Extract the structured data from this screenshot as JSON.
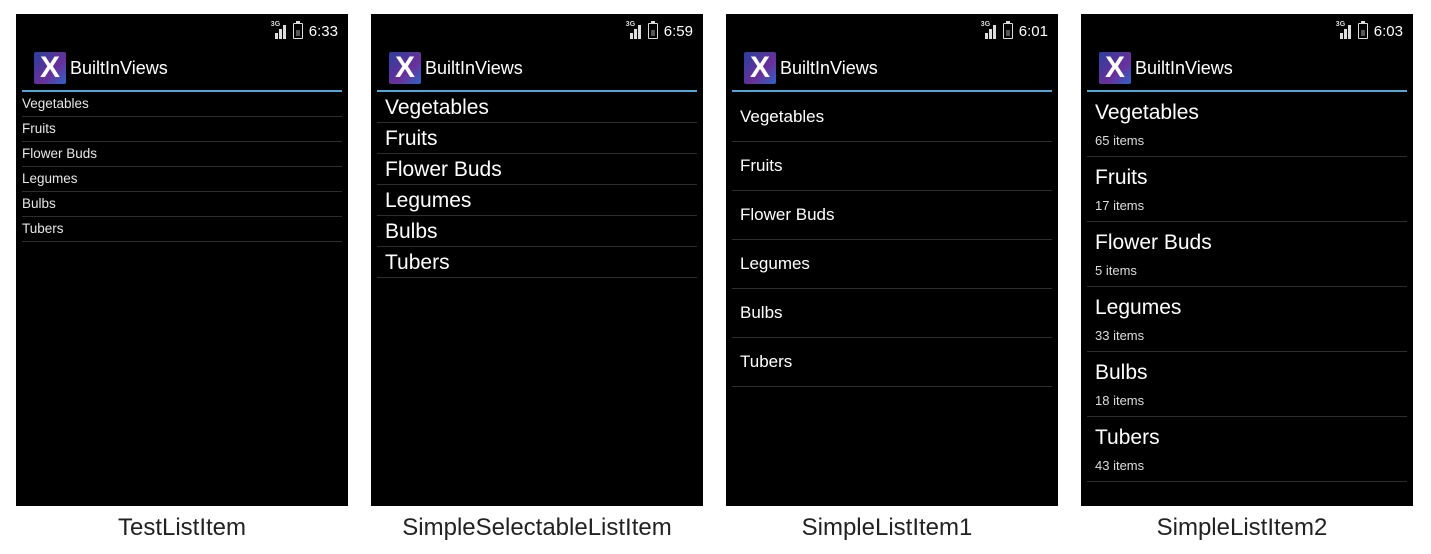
{
  "app": {
    "title": "BuiltInViews"
  },
  "panels": [
    {
      "caption": "TestListItem",
      "time": "6:33",
      "items": [
        "Vegetables",
        "Fruits",
        "Flower Buds",
        "Legumes",
        "Bulbs",
        "Tubers"
      ]
    },
    {
      "caption": "SimpleSelectableListItem",
      "time": "6:59",
      "items": [
        "Vegetables",
        "Fruits",
        "Flower Buds",
        "Legumes",
        "Bulbs",
        "Tubers"
      ]
    },
    {
      "caption": "SimpleListItem1",
      "time": "6:01",
      "items": [
        "Vegetables",
        "Fruits",
        "Flower Buds",
        "Legumes",
        "Bulbs",
        "Tubers"
      ]
    },
    {
      "caption": "SimpleListItem2",
      "time": "6:03",
      "items": [
        {
          "label": "Vegetables",
          "sub": "65 items"
        },
        {
          "label": "Fruits",
          "sub": "17 items"
        },
        {
          "label": "Flower Buds",
          "sub": "5 items"
        },
        {
          "label": "Legumes",
          "sub": "33 items"
        },
        {
          "label": "Bulbs",
          "sub": "18 items"
        },
        {
          "label": "Tubers",
          "sub": "43 items"
        }
      ]
    }
  ],
  "icons": {
    "signal": "3g-signal-icon",
    "battery": "battery-icon",
    "logo": "xamarin-logo-icon"
  },
  "colors": {
    "accent": "#4fa7d8",
    "background": "#000000"
  }
}
